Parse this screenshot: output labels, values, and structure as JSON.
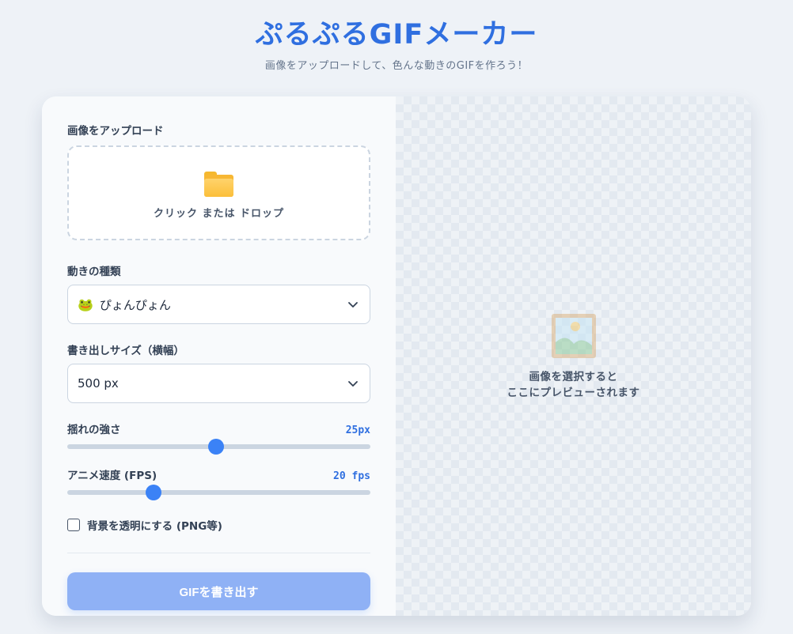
{
  "header": {
    "title": "ぷるぷるGIFメーカー",
    "subtitle": "画像をアップロードして、色んな動きのGIFを作ろう！"
  },
  "upload": {
    "label": "画像をアップロード",
    "dropzone_text": "クリック または ドロップ",
    "icon": "folder-icon"
  },
  "motion": {
    "label": "動きの種類",
    "icon": "frog-emoji",
    "emoji": "🐸",
    "selected": "ぴょんぴょん"
  },
  "size": {
    "label": "書き出しサイズ（横幅）",
    "selected": "500 px"
  },
  "shake": {
    "label": "揺れの強さ",
    "value_text": "25px",
    "fraction": 0.49
  },
  "speed": {
    "label": "アニメ速度 (FPS)",
    "value_text": "20 fps",
    "fraction": 0.285
  },
  "transparent": {
    "label": "背景を透明にする (PNG等)",
    "checked": false
  },
  "export": {
    "label": "GIFを書き出す"
  },
  "preview": {
    "line1": "画像を選択すると",
    "line2": "ここにプレビューされます",
    "icon": "picture-icon"
  },
  "colors": {
    "accent": "#2f6fe0",
    "slider_thumb": "#3b82f6",
    "export_button": "#8fb1f5",
    "background": "#eef2f7"
  }
}
